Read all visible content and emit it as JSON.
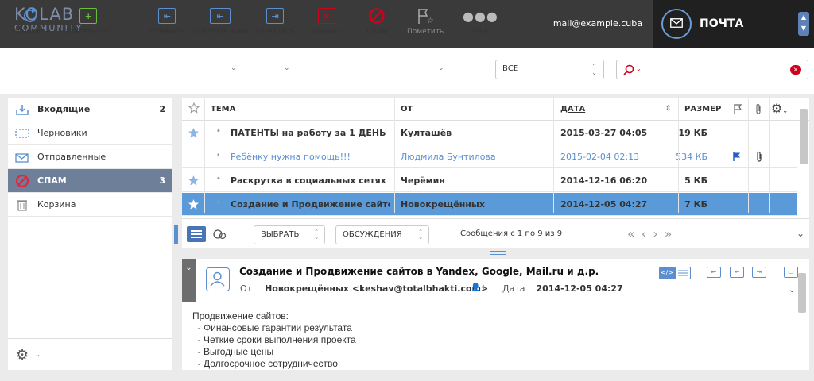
{
  "header": {
    "logo_line1": "KOLAB",
    "logo_line2": "COMMUNITY",
    "user_email": "mail@example.cuba",
    "app_title": "ПОЧТА"
  },
  "toolbar": {
    "refresh": "Обновить",
    "compose": "Написать соо...",
    "reply": "Ответить",
    "reply_all": "Ответить всем",
    "forward": "Переслать",
    "delete": "Удалить",
    "spam": "СПАМ",
    "mark": "Пометить",
    "more": "Еще",
    "filter_value": "ВСЕ",
    "search_value": ""
  },
  "folders": [
    {
      "name": "Входящие",
      "count": "2",
      "icon": "inbox-icon",
      "selected": false,
      "bold": true
    },
    {
      "name": "Черновики",
      "count": "",
      "icon": "drafts-icon",
      "selected": false,
      "bold": false
    },
    {
      "name": "Отправленные",
      "count": "",
      "icon": "sent-icon",
      "selected": false,
      "bold": false
    },
    {
      "name": "СПАМ",
      "count": "3",
      "icon": "spam-icon",
      "selected": true,
      "bold": true
    },
    {
      "name": "Корзина",
      "count": "",
      "icon": "trash-icon",
      "selected": false,
      "bold": false
    }
  ],
  "list": {
    "columns": {
      "subject": "ТЕМА",
      "from": "ОТ",
      "date": "ДАТА",
      "size": "РАЗМЕР"
    },
    "rows": [
      {
        "subject": "ПАТЕНТЫ на работу за 1 ДЕНЬ ...",
        "from": "Култашёв",
        "date": "2015-03-27 04:05",
        "size": "19 КБ",
        "unread": true,
        "flagged": false,
        "attachment": false,
        "selected": false,
        "starred": true
      },
      {
        "subject": "Ребёнку нужна помощь!!!",
        "from": "Людмила Бунтилова",
        "date": "2015-02-04 02:13",
        "size": "534 КБ",
        "unread": false,
        "flagged": true,
        "attachment": true,
        "selected": false,
        "starred": false
      },
      {
        "subject": "Раскрутка в социальных сетях ...",
        "from": "Черёмин",
        "date": "2014-12-16 06:20",
        "size": "5 КБ",
        "unread": true,
        "flagged": false,
        "attachment": false,
        "selected": false,
        "starred": true
      },
      {
        "subject": "Создание и Продвижение сайто...",
        "from": "Новокрещённых",
        "date": "2014-12-05 04:27",
        "size": "7 КБ",
        "unread": true,
        "flagged": false,
        "attachment": false,
        "selected": true,
        "starred": true
      }
    ],
    "select_label": "ВЫБРАТЬ",
    "threads_label": "ОБСУЖДЕНИЯ",
    "count_text": "Сообщения с 1 по 9 из 9"
  },
  "preview": {
    "subject": "Создание и Продвижение сайтов в Yandex, Google, Mail.ru и д.р.",
    "from_label": "От",
    "from_value": "Новокрещённых <keshav@totalbhakti.com>",
    "date_label": "Дата",
    "date_value": "2014-12-05 04:27",
    "body": [
      "Продвижение сайтов:",
      "  - Финансовые гарантии результата",
      "  - Четкие сроки выполнения проекта",
      "  - Выгодные цены",
      "  - Долгосрочное сотрудничество"
    ]
  },
  "colors": {
    "accent": "#5b8fd0",
    "header_bg": "#3a3a3a",
    "selected_folder": "#6d7f99",
    "selected_row": "#5b9ad8"
  }
}
